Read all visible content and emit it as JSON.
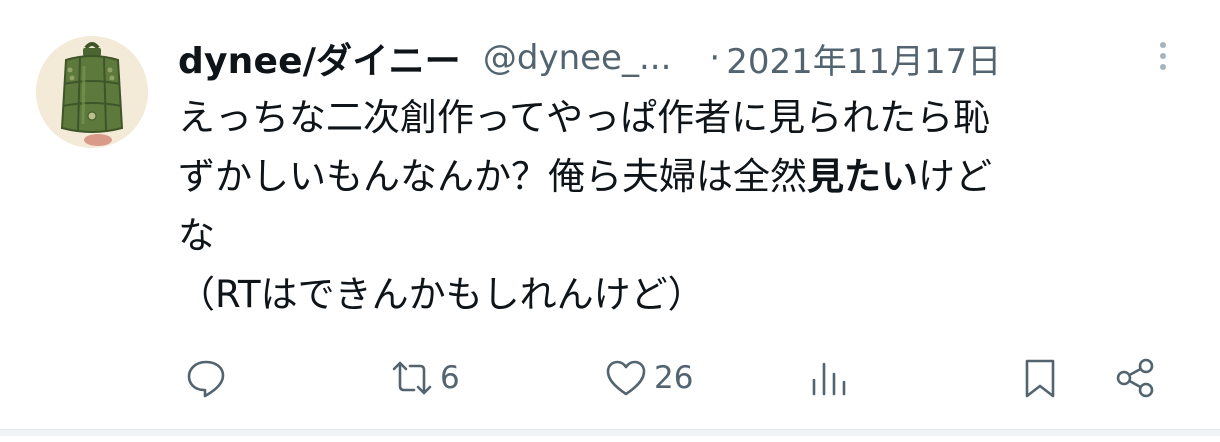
{
  "tweet": {
    "author_name": "dynee/ダイニー",
    "handle": "@dynee_...",
    "separator": "·",
    "date": "2021年11月17日",
    "text_line1": "えっちな二次創作ってやっぱ作者に見られたら恥",
    "text_line2_pre": "ずかしいもんなんか？俺ら夫婦は全然",
    "text_line2_bold": "見たい",
    "text_line2_post": "けど",
    "text_line3": "な",
    "text_line4": "（RTはできんかもしれんけど）"
  },
  "actions": {
    "reply_count": "",
    "retweet_count": "6",
    "like_count": "26",
    "views_count": ""
  },
  "icons": {
    "avatar": "temple-bell-avatar",
    "more": "more-vertical-icon",
    "reply": "reply-icon",
    "retweet": "retweet-icon",
    "like": "heart-icon",
    "views": "bar-chart-icon",
    "bookmark": "bookmark-icon",
    "share": "share-icon"
  },
  "colors": {
    "text": "#0f1419",
    "secondary": "#536471",
    "avatar_bg": "#f4ead8",
    "bell": "#5d7a3c"
  }
}
